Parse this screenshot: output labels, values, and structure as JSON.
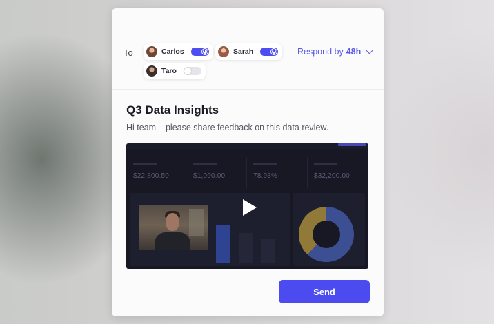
{
  "compose": {
    "to_label": "To",
    "recipients": [
      {
        "name": "Carlos",
        "enabled": true,
        "timer": true
      },
      {
        "name": "Sarah",
        "enabled": true,
        "timer": true
      },
      {
        "name": "Taro",
        "enabled": false,
        "timer": false
      }
    ],
    "respond_by": {
      "label": "Respond by",
      "value": "48h"
    },
    "title": "Q3 Data Insights",
    "message": "Hi team – please share feedback on this data review.",
    "send_label": "Send"
  },
  "video": {
    "stats": [
      "$22,800.50",
      "$1,090.00",
      "78.93%",
      "$32,200.00"
    ]
  },
  "colors": {
    "accent": "#4b4bf0",
    "video_bg": "#1c1d2a",
    "donut_primary": "#4c63b8",
    "donut_secondary": "#b89a42"
  }
}
